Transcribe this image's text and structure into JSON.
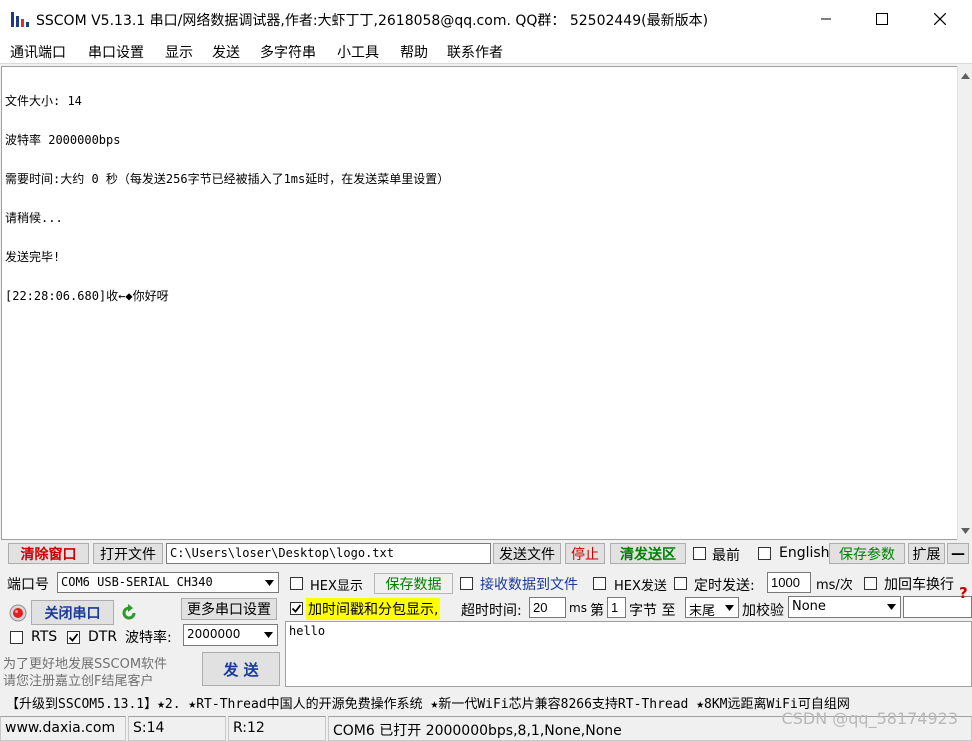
{
  "window": {
    "title": "SSCOM V5.13.1 串口/网络数据调试器,作者:大虾丁丁,2618058@qq.com. QQ群： 52502449(最新版本)"
  },
  "menu": [
    "通讯端口",
    "串口设置",
    "显示",
    "发送",
    "多字符串",
    "小工具",
    "帮助",
    "联系作者"
  ],
  "receive": {
    "lines": [
      "文件大小: 14",
      "波特率 2000000bps",
      "需要时间:大约 0 秒（每发送256字节已经被插入了1ms延时，在发送菜单里设置）",
      "请稍候...",
      "发送完毕!",
      "[22:28:06.680]收←◆你好呀"
    ]
  },
  "file_row": {
    "clear_window": "清除窗口",
    "open_file": "打开文件",
    "file_path": "C:\\Users\\loser\\Desktop\\logo.txt",
    "send_file": "发送文件",
    "stop": "停止",
    "clear_send_area": "清发送区",
    "topmost": "最前",
    "english": "English",
    "save_params": "保存参数",
    "expand": "扩展",
    "collapse": "—"
  },
  "port": {
    "port_label": "端口号",
    "port_value": "COM6 USB-SERIAL CH340",
    "close_port": "关闭串口",
    "more_settings": "更多串口设置",
    "rts": "RTS",
    "dtr": "DTR",
    "baud_label": "波特率:",
    "baud_value": "2000000",
    "promo_line1": "为了更好地发展SSCOM软件",
    "promo_line2": "请您注册嘉立创F结尾客户",
    "send": "发  送"
  },
  "options": {
    "hex_display": "HEX显示",
    "save_data": "保存数据",
    "recv_to_file": "接收数据到文件",
    "hex_send": "HEX发送",
    "timed_send": "定时发送:",
    "interval": "1000",
    "interval_unit": "ms/次",
    "add_crlf": "加回车换行",
    "timestamp": "加时间戳和分包显示,",
    "timeout_label": "超时时间:",
    "timeout_value": "20",
    "timeout_unit": "ms",
    "nth_label": "第",
    "nth_value": "1",
    "byte_label": "字节 至",
    "end_value": "末尾",
    "checksum_label": "加校验",
    "checksum_value": "None"
  },
  "send_text": "hello",
  "ticker": "【升级到SSCOM5.13.1】★2. ★RT-Thread中国人的开源免费操作系统 ★新一代WiFi芯片兼容8266支持RT-Thread ★8KM远距离WiFi可自组网",
  "status": {
    "site": "www.daxia.com",
    "sent": "S:14",
    "recv": "R:12",
    "port_state": "COM6 已打开  2000000bps,8,1,None,None"
  },
  "watermark": "CSDN @qq_58174923",
  "colors": {
    "accent_red": "#d00000",
    "accent_green": "#008000",
    "timestamp_highlight": "#ffff00",
    "help_icon": "#cc0000"
  }
}
